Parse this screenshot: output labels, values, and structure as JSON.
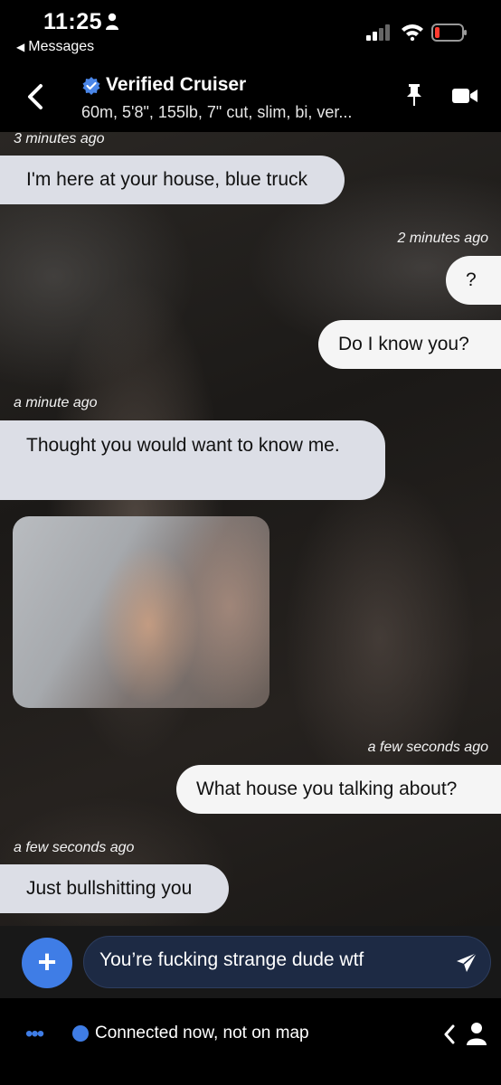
{
  "status_bar": {
    "time": "11:25",
    "back_app_label": "Messages",
    "icons": [
      "person-icon",
      "signal-icon",
      "wifi-icon",
      "battery-low-icon"
    ]
  },
  "header": {
    "name": "Verified Cruiser",
    "stats": "60m, 5'8\", 155lb, 7\" cut, slim, bi, ver...",
    "icons": [
      "back-chevron-icon",
      "verified-badge-icon",
      "pin-icon",
      "video-camera-icon"
    ]
  },
  "messages": [
    {
      "type": "timestamp",
      "side": "incoming",
      "text": "3 minutes ago"
    },
    {
      "type": "text",
      "side": "incoming",
      "text": "I'm here at your house, blue truck"
    },
    {
      "type": "timestamp",
      "side": "outgoing",
      "text": "2 minutes ago"
    },
    {
      "type": "text",
      "side": "outgoing",
      "text": "?"
    },
    {
      "type": "text",
      "side": "outgoing",
      "text": "Do I know you?"
    },
    {
      "type": "timestamp",
      "side": "incoming",
      "text": "a minute ago"
    },
    {
      "type": "text",
      "side": "incoming",
      "text": "Thought you would want to know me."
    },
    {
      "type": "photo",
      "side": "incoming"
    },
    {
      "type": "timestamp",
      "side": "outgoing",
      "text": "a few seconds ago"
    },
    {
      "type": "text",
      "side": "outgoing",
      "text": "What house you talking about?"
    },
    {
      "type": "timestamp",
      "side": "incoming",
      "text": "a few seconds ago"
    },
    {
      "type": "text",
      "side": "incoming",
      "text": "Just bullshitting you"
    }
  ],
  "composer": {
    "add_label": "+",
    "input_value": "You’re fucking strange dude wtf"
  },
  "bottom_bar": {
    "more_label": "•••",
    "status_text": "Connected now, not on map"
  },
  "colors": {
    "accent": "#3f7de6",
    "incoming_bubble": "#dcdee6",
    "outgoing_bubble": "#f5f5f5",
    "input_background": "#1d2a44"
  }
}
